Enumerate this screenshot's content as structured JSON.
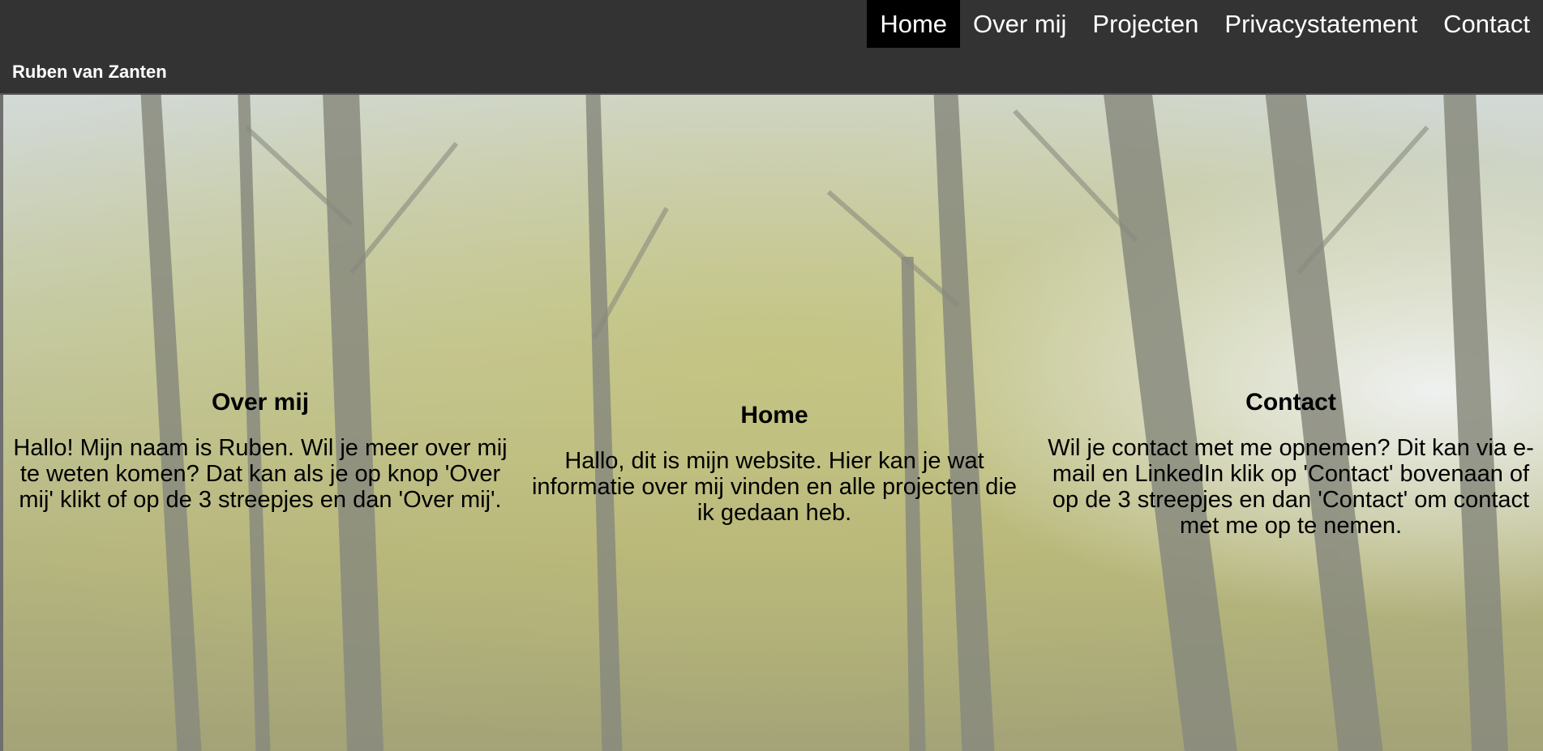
{
  "header": {
    "site_name": "Ruben van Zanten",
    "nav": [
      {
        "label": "Home",
        "active": true
      },
      {
        "label": "Over mij",
        "active": false
      },
      {
        "label": "Projecten",
        "active": false
      },
      {
        "label": "Privacystatement",
        "active": false
      },
      {
        "label": "Contact",
        "active": false
      }
    ]
  },
  "sections": [
    {
      "title": "Over mij",
      "text": "Hallo! Mijn naam is Ruben. Wil je meer over mij te weten komen? Dat kan als je op knop 'Over mij' klikt of op de 3 streepjes en dan 'Over mij'."
    },
    {
      "title": "Home",
      "text": "Hallo, dit is mijn website. Hier kan je wat informatie over mij vinden en alle projecten die ik gedaan heb."
    },
    {
      "title": "Contact",
      "text": "Wil je contact met me opnemen? Dit kan via e-mail en LinkedIn klik op 'Contact' bovenaan of op de 3 streepjes en dan 'Contact' om contact met me op te nemen."
    }
  ],
  "colors": {
    "navbar": "#333333",
    "active_nav": "#000000",
    "text": "#000000"
  }
}
